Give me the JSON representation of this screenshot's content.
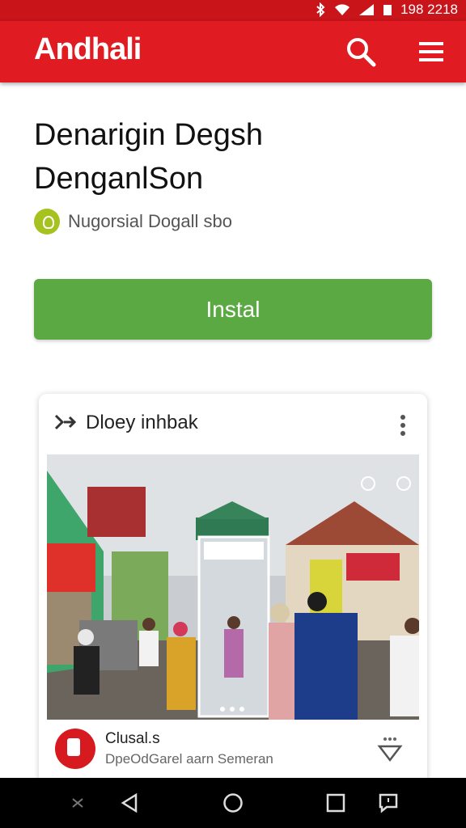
{
  "status_bar": {
    "time": "198 2218"
  },
  "app_bar": {
    "brand": "Andhali"
  },
  "app": {
    "title_line1": "Denarigin Degsh",
    "title_line2": "DenganlSon",
    "developer": "Nugorsial Dogall sbo",
    "install_label": "Instal"
  },
  "card": {
    "header_label": "Dloey inhbak",
    "app_name": "Clusal.s",
    "app_description": "DpeOdGarel aarn Semeran"
  },
  "colors": {
    "accent_red": "#e01b22",
    "install_green": "#5aa942",
    "dev_dot": "#a5c21e"
  }
}
